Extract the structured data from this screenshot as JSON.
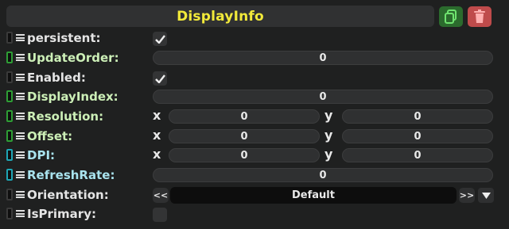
{
  "component": {
    "title": "DisplayInfo"
  },
  "icons": {
    "copy": "copy-icon",
    "delete": "trash-icon",
    "pin": "pin-icon",
    "menu": "hamburger-icon",
    "check": "check-icon"
  },
  "colors": {
    "title": "#f2ea3a",
    "green": "#2e9d35",
    "cyan": "#1ea6b5",
    "delete": "#bf4b4b",
    "copy": "#2b6b2d"
  },
  "fields": {
    "persistent": {
      "label": "persistent:",
      "checked": true
    },
    "update_order": {
      "label": "UpdateOrder:",
      "value": "0"
    },
    "enabled": {
      "label": "Enabled:",
      "checked": true
    },
    "display_index": {
      "label": "DisplayIndex:",
      "value": "0"
    },
    "resolution": {
      "label": "Resolution:",
      "x_label": "x",
      "x": "0",
      "y_label": "y",
      "y": "0"
    },
    "offset": {
      "label": "Offset:",
      "x_label": "x",
      "x": "0",
      "y_label": "y",
      "y": "0"
    },
    "dpi": {
      "label": "DPI:",
      "x_label": "x",
      "x": "0",
      "y_label": "y",
      "y": "0"
    },
    "refresh_rate": {
      "label": "RefreshRate:",
      "value": "0"
    },
    "orientation": {
      "label": "Orientation:",
      "prev": "<<",
      "value": "Default",
      "next": ">>"
    },
    "is_primary": {
      "label": "IsPrimary:",
      "checked": false
    }
  }
}
